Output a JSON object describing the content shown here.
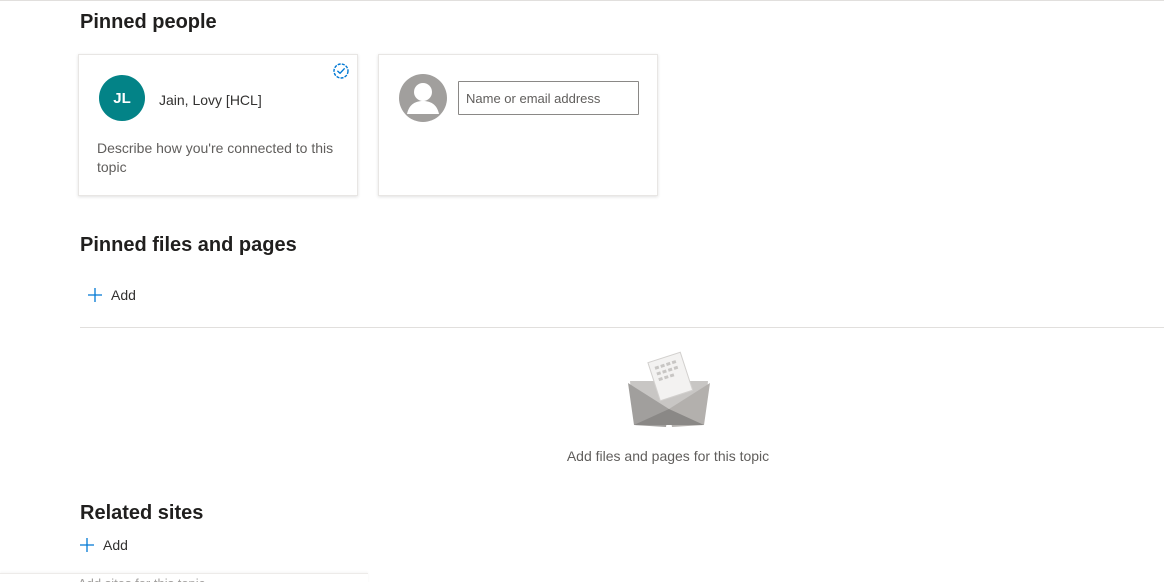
{
  "pinned_people": {
    "title": "Pinned people",
    "person": {
      "initials": "JL",
      "name": "Jain, Lovy [HCL]",
      "description": "Describe how you're connected to this topic"
    },
    "add_person": {
      "placeholder": "Name or email address"
    }
  },
  "pinned_files": {
    "title": "Pinned files and pages",
    "add_label": "Add",
    "empty_message": "Add files and pages for this topic"
  },
  "related_sites": {
    "title": "Related sites",
    "add_label": "Add",
    "empty_message": "Add sites for this topic"
  },
  "colors": {
    "avatar_bg": "#038387",
    "accent": "#0078d4"
  }
}
